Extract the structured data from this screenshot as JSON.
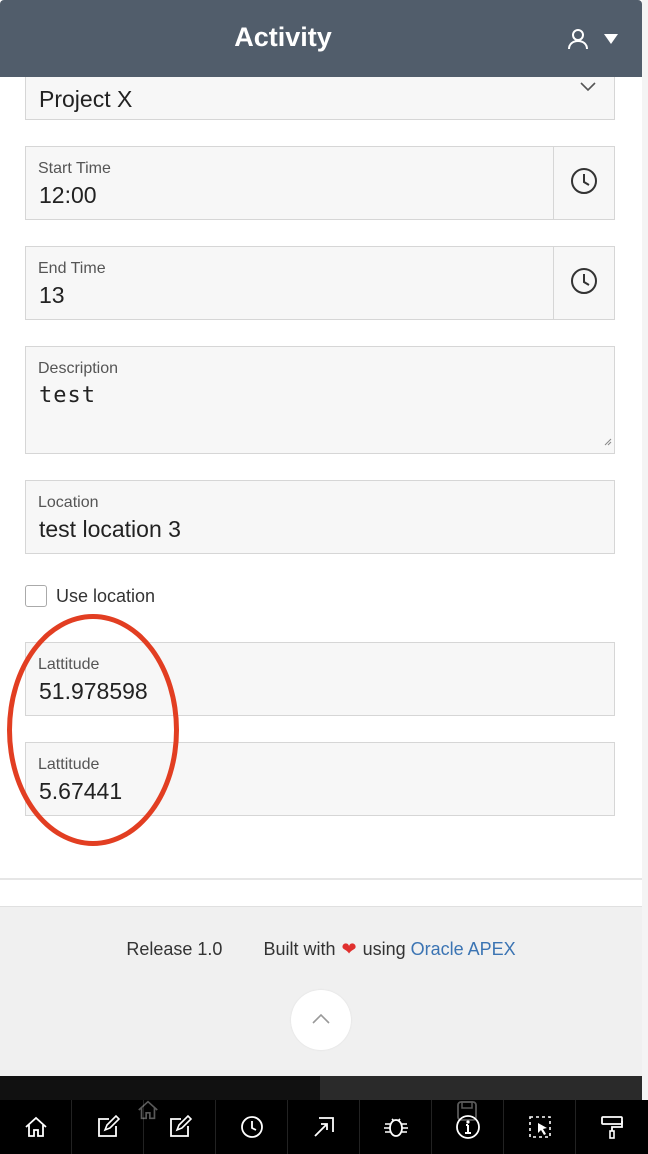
{
  "header": {
    "title": "Activity",
    "user_icon": "user-icon",
    "caret_icon": "caret-down-icon"
  },
  "form": {
    "project": {
      "value": "Project X",
      "icon": "chevron-down-icon"
    },
    "start_time": {
      "label": "Start Time",
      "value": "12:00",
      "icon": "clock-icon"
    },
    "end_time": {
      "label": "End Time",
      "value": "13",
      "icon": "clock-icon"
    },
    "description": {
      "label": "Description",
      "value": "test"
    },
    "location": {
      "label": "Location",
      "value": "test location 3"
    },
    "use_location": {
      "label": "Use location",
      "checked": false
    },
    "latitude": {
      "label": "Lattitude",
      "value": "51.978598"
    },
    "longitude": {
      "label": "Lattitude",
      "value": "5.67441"
    }
  },
  "annotation": {
    "color": "#e23e22",
    "shape": "ellipse"
  },
  "footer": {
    "release": "Release 1.0",
    "built_with": "Built with",
    "using": "using",
    "link": "Oracle APEX",
    "heart_color": "#e0302e",
    "link_color": "#3b74b3",
    "scroll_top_icon": "chevron-up-icon"
  },
  "dev_toolbar": {
    "buttons": [
      "home-icon",
      "edit-page-icon",
      "session-icon",
      "quick-edit-icon",
      "debug-icon",
      "info-icon",
      "select-region-icon",
      "theme-roller-icon"
    ]
  },
  "colors": {
    "header_bg": "#515d6b",
    "field_bg": "#f7f7f7",
    "footer_bg": "#f0f0f0"
  }
}
